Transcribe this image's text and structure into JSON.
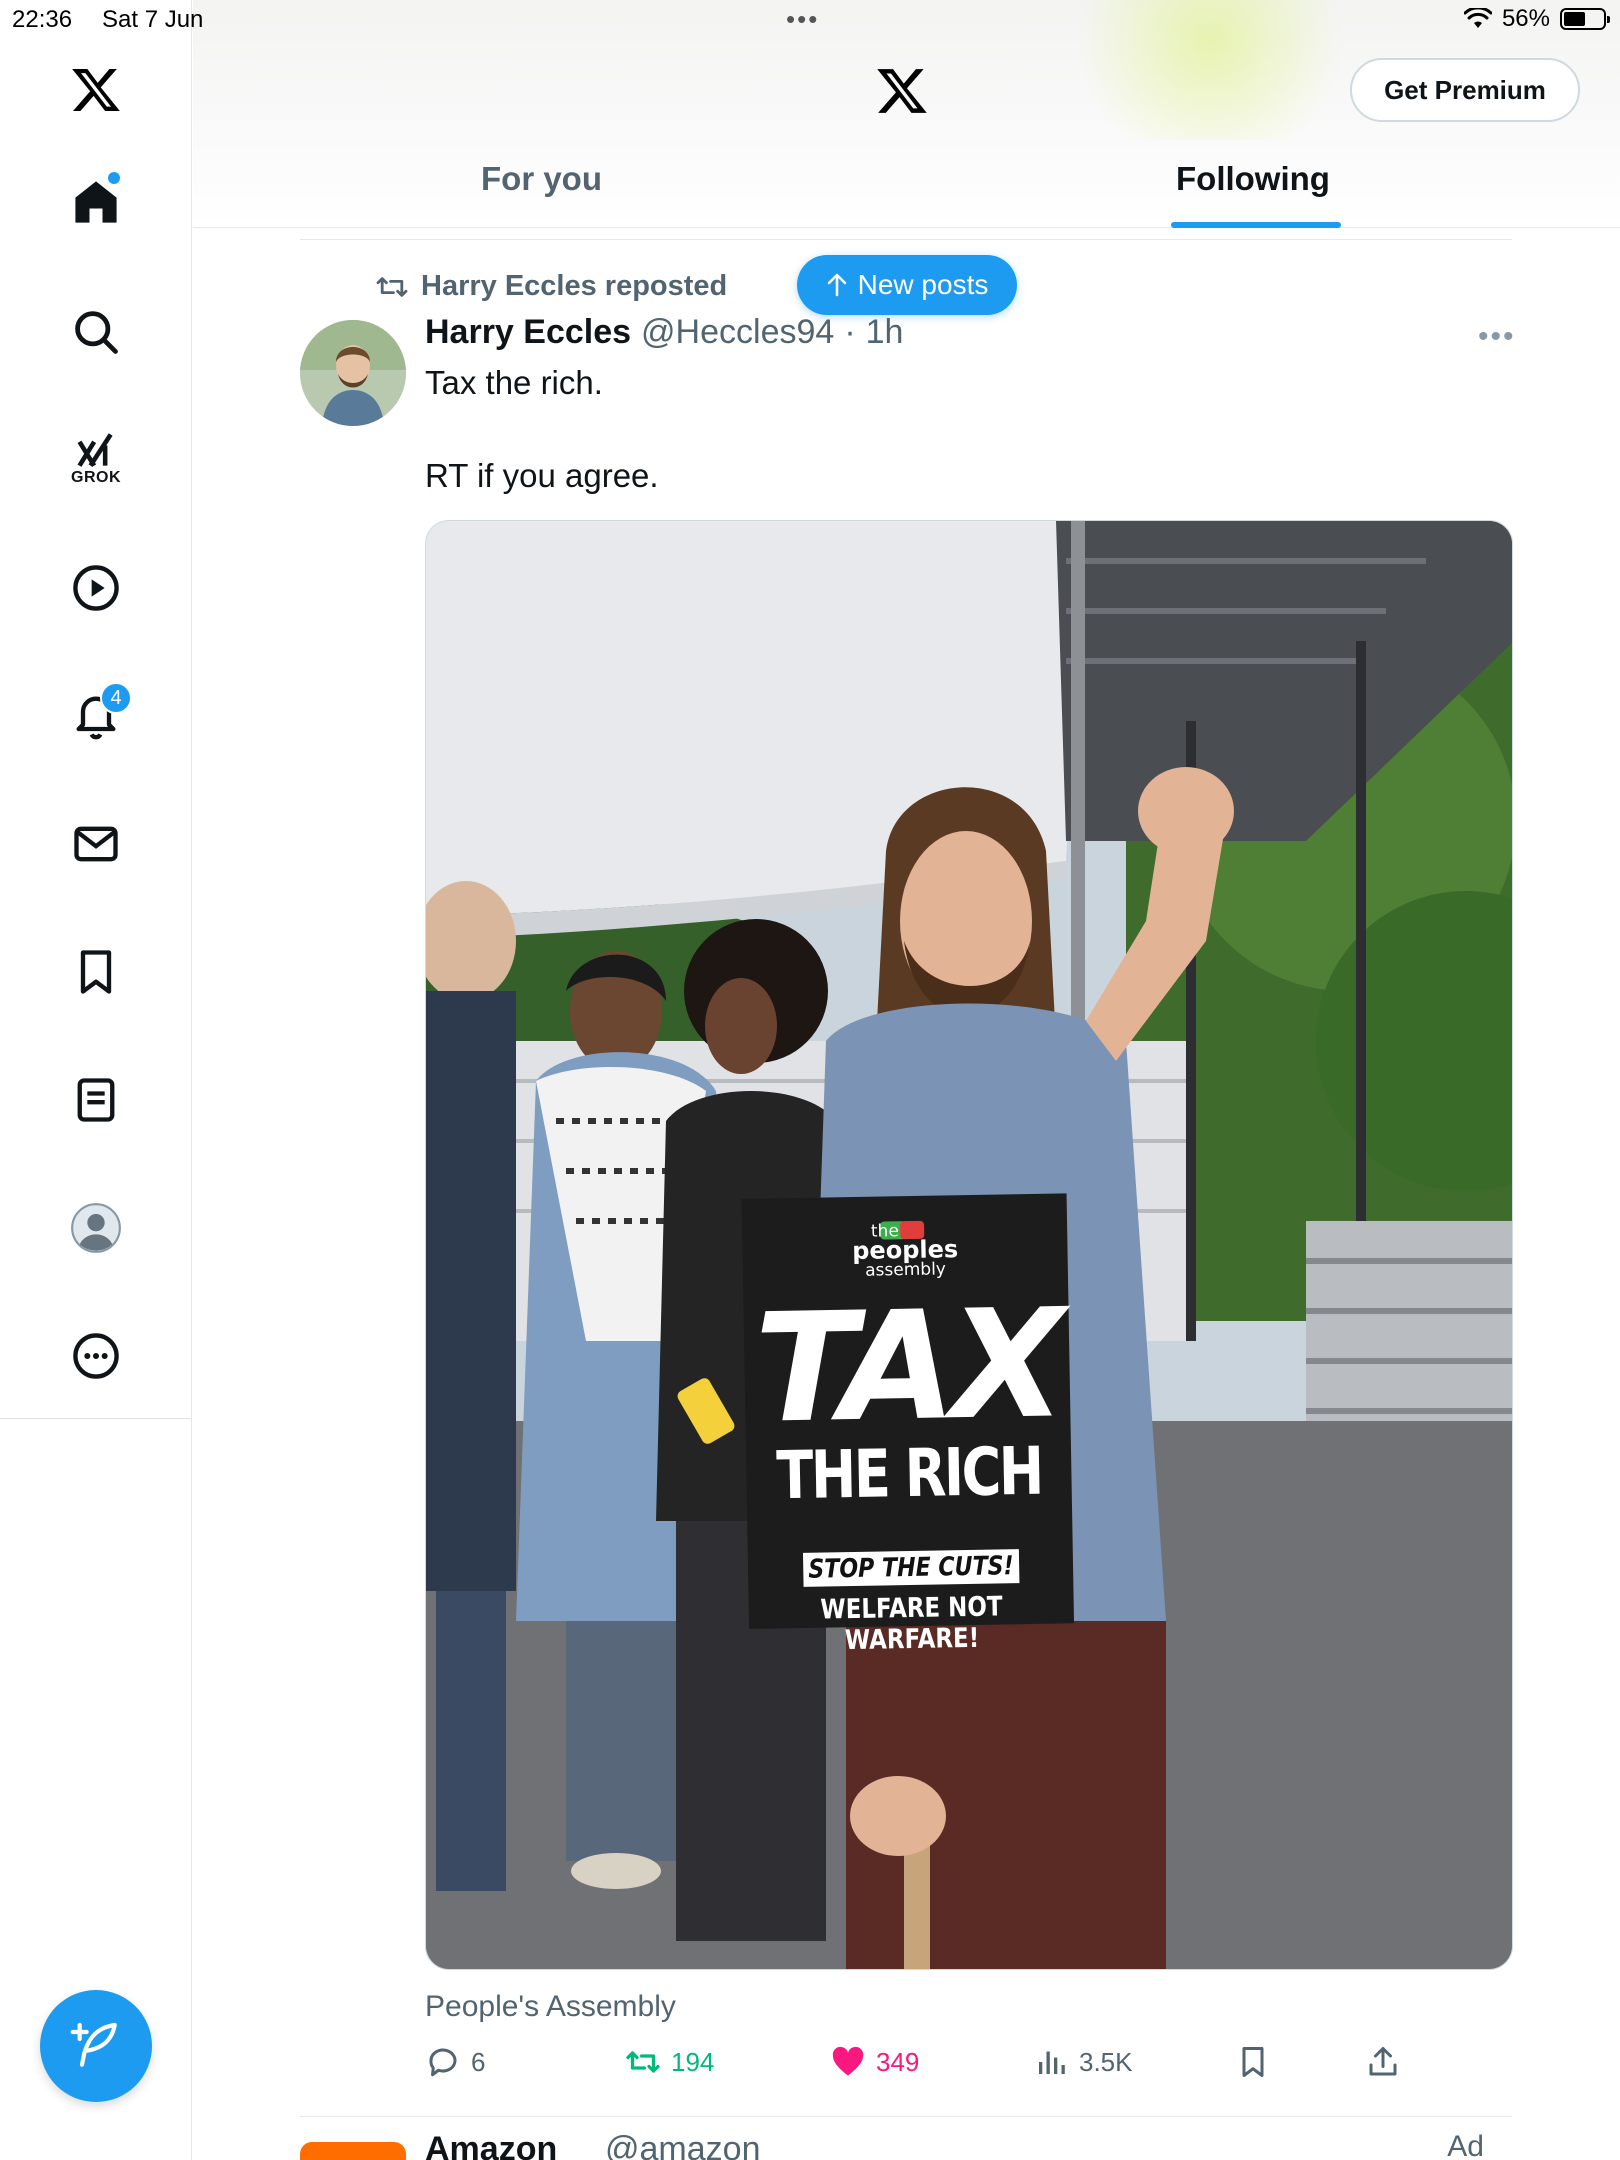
{
  "status_bar": {
    "time": "22:36",
    "date": "Sat 7 Jun",
    "battery": "56%",
    "battery_level": 0.56
  },
  "sidebar": {
    "items": [
      {
        "name": "home",
        "icon": "home-icon"
      },
      {
        "name": "search",
        "icon": "search-icon"
      },
      {
        "name": "grok",
        "icon": "grok-icon",
        "label": "GROK"
      },
      {
        "name": "video",
        "icon": "play-icon"
      },
      {
        "name": "notifications",
        "icon": "bell-icon",
        "badge": "4"
      },
      {
        "name": "messages",
        "icon": "mail-icon"
      },
      {
        "name": "bookmarks",
        "icon": "bookmark-icon"
      },
      {
        "name": "lists",
        "icon": "list-icon"
      },
      {
        "name": "profile",
        "icon": "profile-avatar-icon"
      },
      {
        "name": "more",
        "icon": "more-circle-icon"
      }
    ],
    "compose_icon": "feather-plus-icon"
  },
  "header": {
    "logo": "x-logo-icon",
    "premium_label": "Get Premium",
    "tabs": [
      {
        "label": "For you",
        "active": false
      },
      {
        "label": "Following",
        "active": true
      }
    ]
  },
  "new_posts_label": "New posts",
  "post": {
    "repost_label": "Harry Eccles reposted",
    "author_name": "Harry Eccles",
    "author_handle": "@Heccles94",
    "time": "1h",
    "text_line1": "Tax the rich.",
    "text_line2": "RT if you agree.",
    "media_credit": "People's Assembly",
    "sign": {
      "org_the": "the",
      "org_name": "peoples",
      "org_sub": "assembly",
      "headline1": "TAX",
      "headline2": "THE RICH",
      "sub1": "STOP THE CUTS!",
      "sub2": "WELFARE NOT WARFARE!"
    },
    "stats": {
      "replies": "6",
      "reposts": "194",
      "likes": "349",
      "views": "3.5K"
    }
  },
  "next_post": {
    "name": "Amazon",
    "handle": "@amazon",
    "ad_label": "Ad"
  },
  "colors": {
    "accent": "#1d9bf0",
    "repost": "#00ba7c",
    "like": "#f91880",
    "muted": "#536471"
  }
}
